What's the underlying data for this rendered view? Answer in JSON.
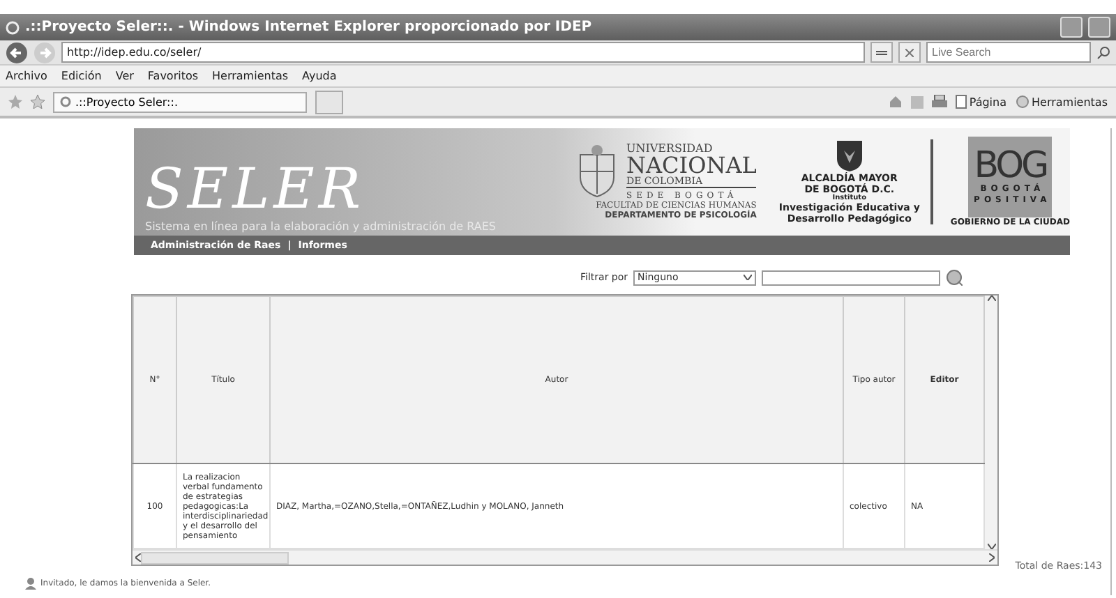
{
  "window": {
    "title": ".::Proyecto Seler::. - Windows Internet Explorer proporcionado por IDEP"
  },
  "browser": {
    "address": "http://idep.edu.co/seler/",
    "search_placeholder": "Live Search",
    "menu": [
      "Archivo",
      "Edición",
      "Ver",
      "Favoritos",
      "Herramientas",
      "Ayuda"
    ],
    "tab": ".::Proyecto Seler::.",
    "commands": [
      "Página",
      "Herramientas"
    ]
  },
  "header": {
    "logo": "SELER",
    "subtitle": "Sistema en línea para la elaboración y administración de RAES",
    "nav": [
      "Administración de Raes",
      "Informes"
    ],
    "nav_separator": "|",
    "university": [
      "UNIVERSIDAD",
      "NACIONAL",
      "DE COLOMBIA",
      "SEDE BOGOTÁ",
      "FACULTAD DE CIENCIAS HUMANAS",
      "DEPARTAMENTO DE PSICOLOGÍA"
    ],
    "alcaldia": [
      "ALCALDÍA MAYOR",
      "DE BOGOTÁ D.C.",
      "Instituto",
      "Investigación Educativa y",
      "Desarrollo Pedagógico"
    ],
    "bog": [
      "BOG",
      "BOGOTÁ",
      "POSITIVA",
      "GOBIERNO DE LA CIUDAD"
    ]
  },
  "filter": {
    "label": "Filtrar por",
    "value": "Ninguno"
  },
  "table": {
    "columns": [
      "N°",
      "Título",
      "Autor",
      "Tipo autor",
      "Editor"
    ],
    "rows": [
      {
        "cells": [
          "100",
          "La realizacion verbal fundamento de estrategias pedagogicas:La interdisciplinariedad y el desarrollo del pensamiento",
          "DIAZ, Martha,=OZANO,Stella,=ONTAÑEZ,Ludhin y MOLANO, Janneth",
          "colectivo",
          "NA"
        ]
      }
    ]
  },
  "footer": {
    "welcome": "Invitado, le damos la bienvenida a Seler.",
    "total": "Total de Raes:143"
  }
}
